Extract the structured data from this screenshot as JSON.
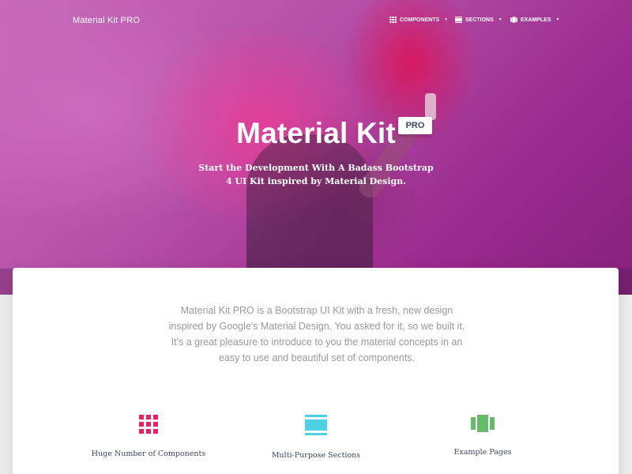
{
  "colors": {
    "accent_pink": "#e91e63",
    "accent_cyan": "#4dd0e1",
    "accent_green": "#66bb6a",
    "hero_purple": "#9c27b0"
  },
  "navbar": {
    "brand": "Material Kit PRO",
    "items": [
      {
        "label": "COMPONENTS",
        "icon": "apps-grid-icon"
      },
      {
        "label": "SECTIONS",
        "icon": "view-day-icon"
      },
      {
        "label": "EXAMPLES",
        "icon": "view-carousel-icon"
      }
    ]
  },
  "hero": {
    "title": "Material Kit",
    "badge": "PRO",
    "subtitle": "Start the Development With A Badass Bootstrap 4 UI Kit inspired by Material Design."
  },
  "intro": {
    "text": "Material Kit PRO is a Bootstrap UI Kit with a fresh, new design inspired by Google's Material Design. You asked for it, so we built it. It's a great pleasure to introduce to you the material concepts in an easy to use and beautiful set of components."
  },
  "features": [
    {
      "label": "Huge Number of Components",
      "icon": "apps-grid-icon",
      "color": "#e91e63"
    },
    {
      "label": "Multi-Purpose Sections",
      "icon": "view-day-icon",
      "color": "#4dd0e1"
    },
    {
      "label": "Example Pages",
      "icon": "view-carousel-icon",
      "color": "#66bb6a"
    }
  ]
}
